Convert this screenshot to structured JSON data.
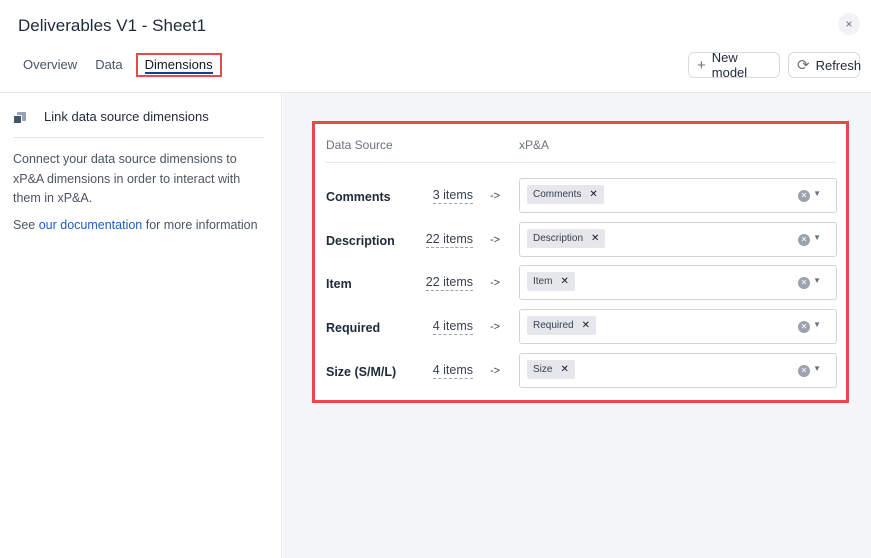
{
  "header": {
    "title": "Deliverables V1 - Sheet1",
    "close_icon": "×",
    "tabs": [
      {
        "label": "Overview",
        "active": false
      },
      {
        "label": "Data",
        "active": false
      },
      {
        "label": "Dimensions",
        "active": true
      }
    ],
    "new_model_label": "New model",
    "new_model_icon": "+",
    "refresh_label": "Refresh",
    "refresh_icon": "⟳"
  },
  "sidebar": {
    "title": "Link data source dimensions",
    "description": "Connect your data source dimensions to xP&A dimensions in order to interact with them in xP&A.",
    "see_prefix": "See ",
    "doc_link": "our documentation",
    "see_suffix": " for more information"
  },
  "mapping": {
    "col_source": "Data Source",
    "col_target": "xP&A",
    "arrow": "->",
    "rows": [
      {
        "name": "Comments",
        "count": "3 items",
        "chip": "Comments"
      },
      {
        "name": "Description",
        "count": "22 items",
        "chip": "Description"
      },
      {
        "name": "Item",
        "count": "22 items",
        "chip": "Item"
      },
      {
        "name": "Required",
        "count": "4 items",
        "chip": "Required"
      },
      {
        "name": "Size (S/M/L)",
        "count": "4 items",
        "chip": "Size"
      }
    ]
  },
  "colors": {
    "highlight": "#e5484d",
    "link": "#1d5fbf",
    "chip_bg": "#e5e7eb"
  }
}
